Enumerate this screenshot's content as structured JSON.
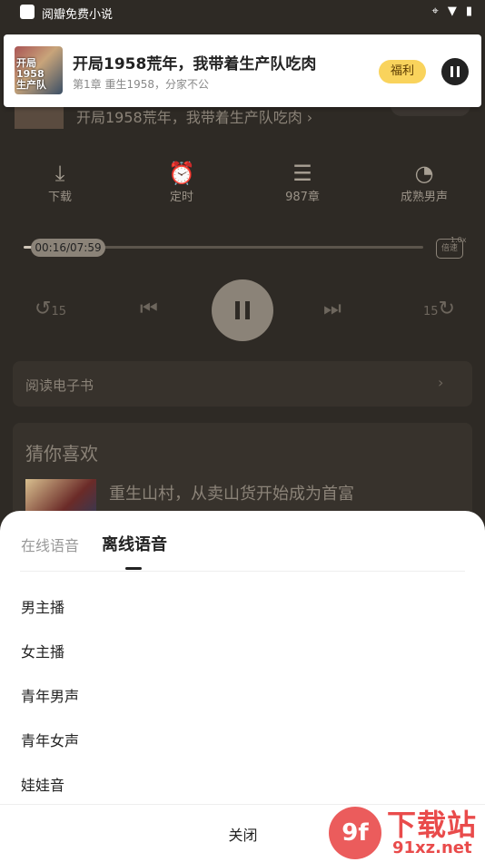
{
  "status_bar": {
    "app_name": "阅瓣免费小说"
  },
  "notification": {
    "title": "开局1958荒年，我带着生产队吃肉",
    "subtitle": "第1章 重生1958，分家不公",
    "cover_text": "开局1958荒年 生产队吃肉",
    "fuli_label": "福利"
  },
  "player": {
    "book_title": "开局1958荒年，我带着生产队吃肉 ›",
    "controls": [
      {
        "label": "下载",
        "icon": "download-icon",
        "glyph": "⤓"
      },
      {
        "label": "定时",
        "icon": "alarm-icon",
        "glyph": "⏰"
      },
      {
        "label": "987章",
        "icon": "list-icon",
        "glyph": "☰"
      },
      {
        "label": "成熟男声",
        "icon": "voice-icon",
        "glyph": "🗣"
      }
    ],
    "time": "00:16/07:59",
    "progress": 0.03,
    "speed_label": "倍速",
    "speed_value": "1.0x",
    "rewind_label": "15",
    "forward_label": "15",
    "read_ebook": "阅读电子书",
    "like_title": "猜你喜欢",
    "like_book": "重生山村，从卖山货开始成为首富"
  },
  "sheet": {
    "tab_online": "在线语音",
    "tab_offline": "离线语音",
    "voices": [
      "男主播",
      "女主播",
      "青年男声",
      "青年女声",
      "娃娃音"
    ],
    "close_label": "关闭"
  },
  "watermark": {
    "logo": "9f",
    "text": "下载站",
    "url": "91xz.net"
  }
}
